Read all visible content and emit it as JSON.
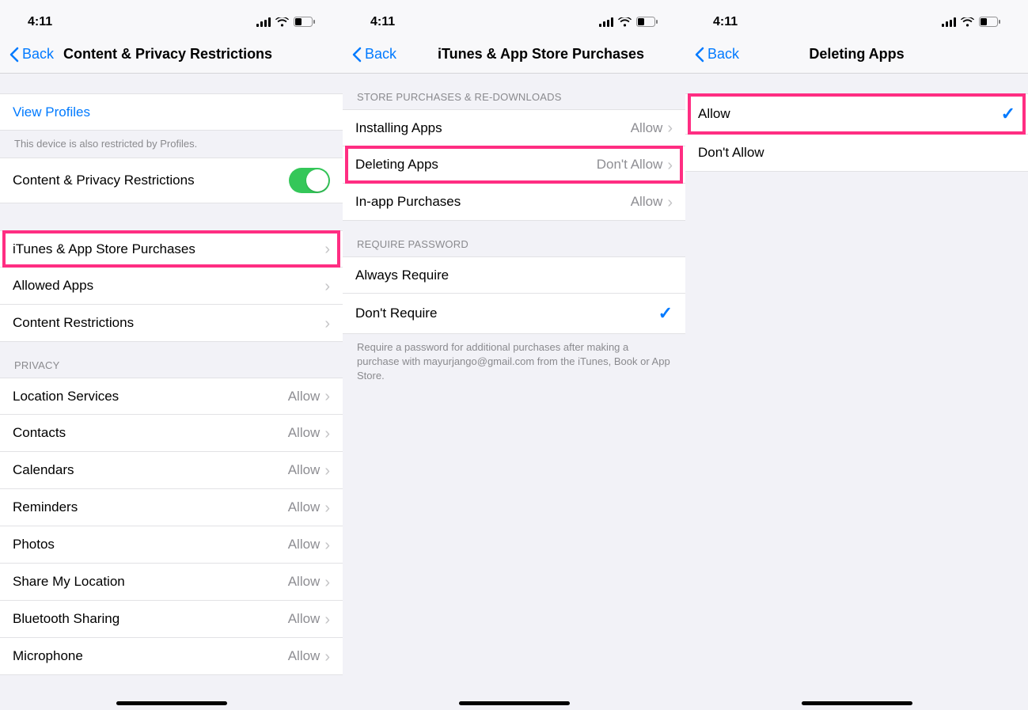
{
  "status": {
    "time": "4:11"
  },
  "screen1": {
    "back": "Back",
    "title": "Content & Privacy Restrictions",
    "viewProfiles": "View Profiles",
    "profilesNote": "This device is also restricted by Profiles.",
    "toggleRow": "Content & Privacy Restrictions",
    "rows": [
      {
        "label": "iTunes & App Store Purchases",
        "highlight": true
      },
      {
        "label": "Allowed Apps"
      },
      {
        "label": "Content Restrictions"
      }
    ],
    "privacyHeader": "PRIVACY",
    "privacy": [
      {
        "label": "Location Services",
        "value": "Allow"
      },
      {
        "label": "Contacts",
        "value": "Allow"
      },
      {
        "label": "Calendars",
        "value": "Allow"
      },
      {
        "label": "Reminders",
        "value": "Allow"
      },
      {
        "label": "Photos",
        "value": "Allow"
      },
      {
        "label": "Share My Location",
        "value": "Allow"
      },
      {
        "label": "Bluetooth Sharing",
        "value": "Allow"
      },
      {
        "label": "Microphone",
        "value": "Allow"
      }
    ]
  },
  "screen2": {
    "back": "Back",
    "title": "iTunes & App Store Purchases",
    "section1Header": "STORE PURCHASES & RE-DOWNLOADS",
    "section1": [
      {
        "label": "Installing Apps",
        "value": "Allow"
      },
      {
        "label": "Deleting Apps",
        "value": "Don't Allow",
        "highlight": true
      },
      {
        "label": "In-app Purchases",
        "value": "Allow"
      }
    ],
    "section2Header": "REQUIRE PASSWORD",
    "section2": [
      {
        "label": "Always Require",
        "checked": false
      },
      {
        "label": "Don't Require",
        "checked": true
      }
    ],
    "section2Footer": "Require a password for additional purchases after making a purchase with mayurjango@gmail.com from the iTunes, Book or App Store."
  },
  "screen3": {
    "back": "Back",
    "title": "Deleting Apps",
    "options": [
      {
        "label": "Allow",
        "checked": true,
        "highlight": true
      },
      {
        "label": "Don't Allow",
        "checked": false
      }
    ]
  }
}
